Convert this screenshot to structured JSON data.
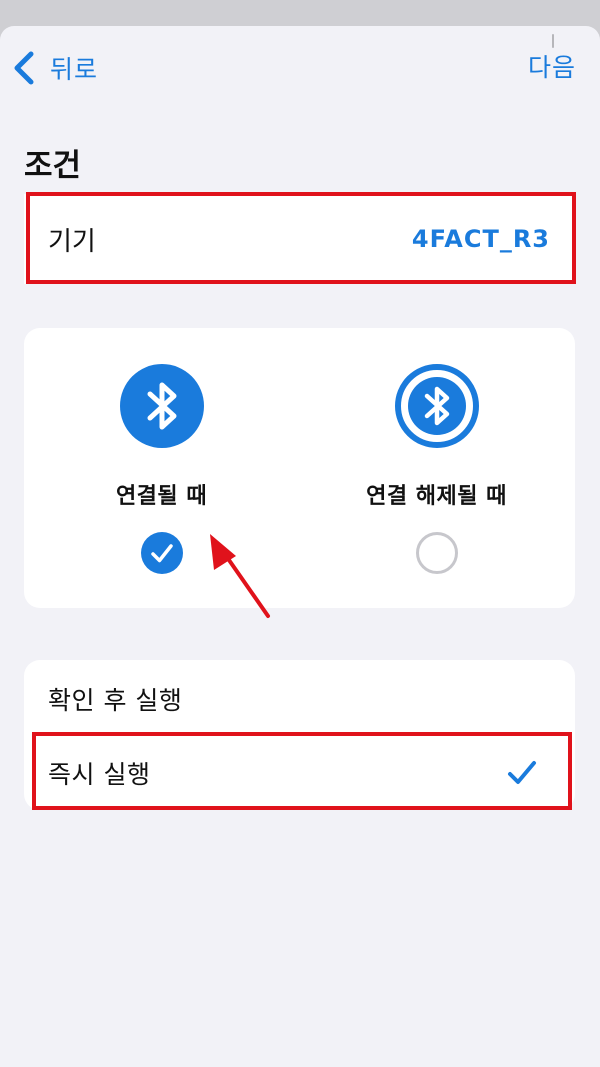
{
  "nav": {
    "back_label": "뒤로",
    "next_label": "다음"
  },
  "section": {
    "title": "조건"
  },
  "device_row": {
    "label": "기기",
    "value": "4FACT_R3"
  },
  "condition_options": [
    {
      "label": "연결될 때",
      "icon": "bluetooth-filled-icon",
      "selected": true
    },
    {
      "label": "연결 해제될 때",
      "icon": "bluetooth-outline-icon",
      "selected": false
    }
  ],
  "run_options": [
    {
      "label": "확인 후 실행",
      "selected": false
    },
    {
      "label": "즉시 실행",
      "selected": true
    }
  ],
  "colors": {
    "accent": "#1a7bdc",
    "annotation": "#e0121b",
    "background": "#f2f2f7"
  }
}
